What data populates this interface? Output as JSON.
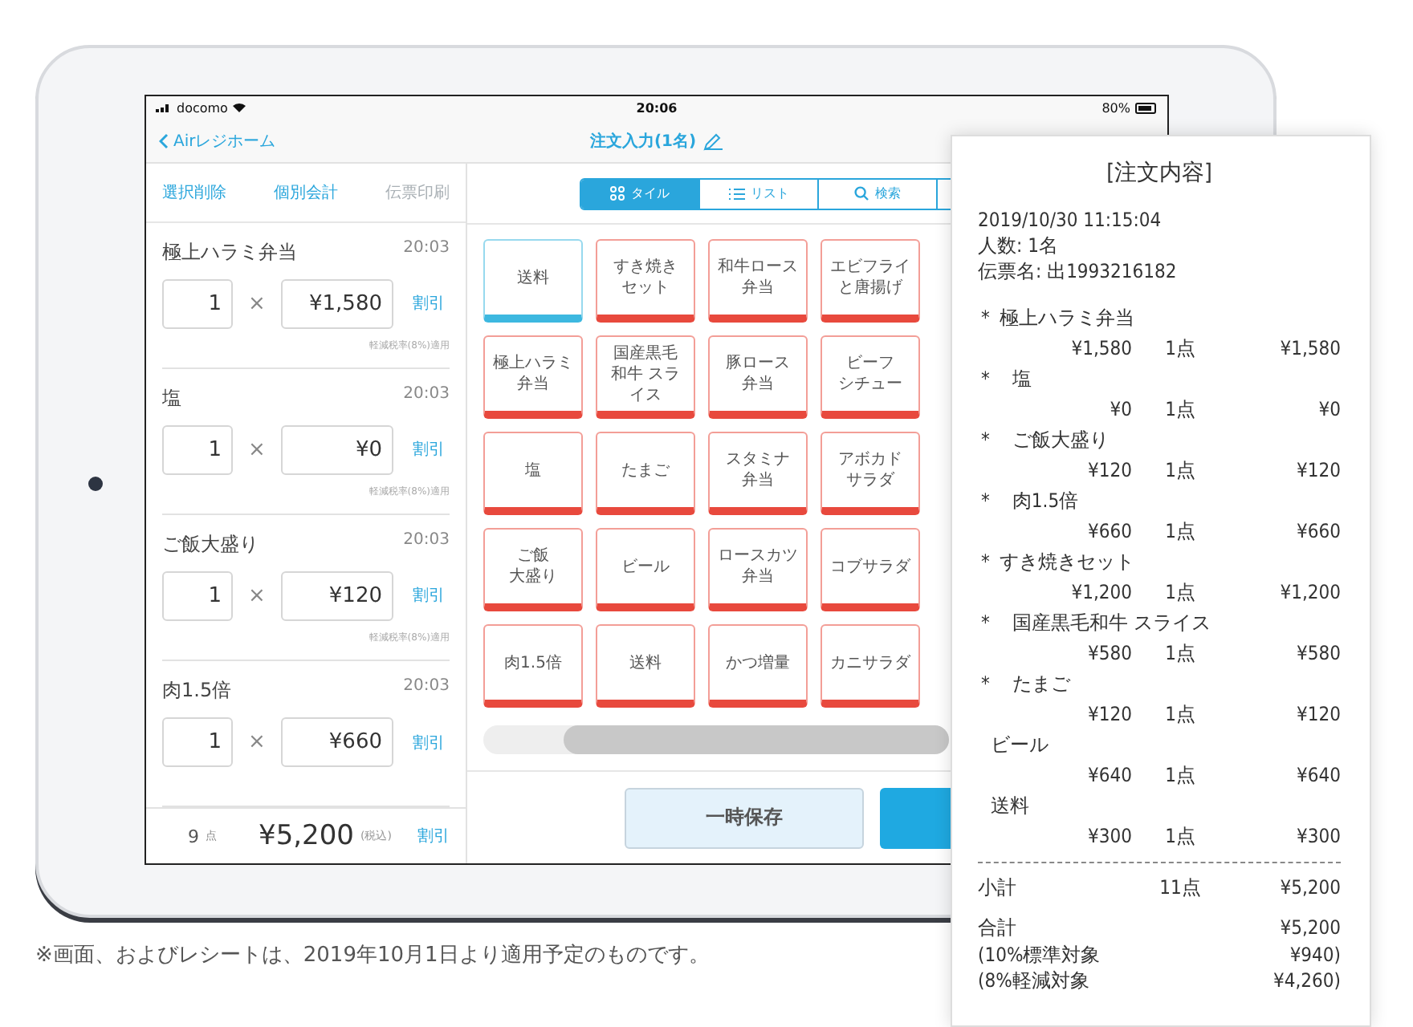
{
  "status_bar": {
    "carrier": "docomo",
    "time": "20:06",
    "battery": "80%"
  },
  "nav": {
    "back_label": "Airレジホーム",
    "title": "注文入力(1名)"
  },
  "actions": [
    {
      "label": "選択削除",
      "disabled": false
    },
    {
      "label": "個別会計",
      "disabled": false
    },
    {
      "label": "伝票印刷",
      "disabled": true
    }
  ],
  "order_items": [
    {
      "name": "極上ハラミ弁当",
      "time": "20:03",
      "qty": "1",
      "times": "×",
      "price": "¥1,580",
      "discount": "割引",
      "tax_note": "軽減税率(8%)適用"
    },
    {
      "name": "塩",
      "time": "20:03",
      "qty": "1",
      "times": "×",
      "price": "¥0",
      "discount": "割引",
      "tax_note": "軽減税率(8%)適用"
    },
    {
      "name": "ご飯大盛り",
      "time": "20:03",
      "qty": "1",
      "times": "×",
      "price": "¥120",
      "discount": "割引",
      "tax_note": "軽減税率(8%)適用"
    },
    {
      "name": "肉1.5倍",
      "time": "20:03",
      "qty": "1",
      "times": "×",
      "price": "¥660",
      "discount": "割引"
    }
  ],
  "footer": {
    "count": "9",
    "unit": "点",
    "total": "¥5,200",
    "tax": "(税込)",
    "discount": "割引"
  },
  "view_tabs": [
    {
      "label": "タイル",
      "kind": "tile",
      "selected": true
    },
    {
      "label": "リスト",
      "kind": "list",
      "selected": false
    },
    {
      "label": "検索",
      "kind": "search",
      "selected": false
    }
  ],
  "tiles": [
    {
      "lines": [
        "送料"
      ],
      "color": "#3db8e0"
    },
    {
      "lines": [
        "すき焼き",
        "セット"
      ],
      "color": "#e8493d"
    },
    {
      "lines": [
        "和牛ロース",
        "弁当"
      ],
      "color": "#e8493d"
    },
    {
      "lines": [
        "エビフライ",
        "と唐揚げ"
      ],
      "color": "#e8493d"
    },
    {
      "lines": [
        "極上ハラミ",
        "弁当"
      ],
      "color": "#e8493d"
    },
    {
      "lines": [
        "国産黒毛",
        "和牛 スラ",
        "イス"
      ],
      "color": "#e8493d"
    },
    {
      "lines": [
        "豚ロース",
        "弁当"
      ],
      "color": "#e8493d"
    },
    {
      "lines": [
        "ビーフ",
        "シチュー"
      ],
      "color": "#e8493d"
    },
    {
      "lines": [
        "塩"
      ],
      "color": "#e8493d"
    },
    {
      "lines": [
        "たまご"
      ],
      "color": "#e8493d"
    },
    {
      "lines": [
        "スタミナ",
        "弁当"
      ],
      "color": "#e8493d"
    },
    {
      "lines": [
        "アボカド",
        "サラダ"
      ],
      "color": "#e8493d"
    },
    {
      "lines": [
        "ご飯",
        "大盛り"
      ],
      "color": "#e8493d"
    },
    {
      "lines": [
        "ビール"
      ],
      "color": "#e8493d"
    },
    {
      "lines": [
        "ロースカツ",
        "弁当"
      ],
      "color": "#e8493d"
    },
    {
      "lines": [
        "コブサラダ"
      ],
      "color": "#e8493d"
    },
    {
      "lines": [
        "肉1.5倍"
      ],
      "color": "#e8493d"
    },
    {
      "lines": [
        "送料"
      ],
      "color": "#e8493d"
    },
    {
      "lines": [
        "かつ増量"
      ],
      "color": "#e8493d"
    },
    {
      "lines": [
        "カニサラダ"
      ],
      "color": "#e8493d"
    }
  ],
  "save_button": "一時保存",
  "receipt": {
    "title": "[注文内容]",
    "datetime": "2019/10/30 11:15:04",
    "people": "人数: 1名",
    "slip": "伝票名: 出1993216182",
    "lines": [
      {
        "mark": "*",
        "name": "極上ハラミ弁当",
        "indent": false,
        "unit_price": "¥1,580",
        "qty": "1点",
        "amount": "¥1,580"
      },
      {
        "mark": "*",
        "name": "塩",
        "indent": true,
        "unit_price": "¥0",
        "qty": "1点",
        "amount": "¥0"
      },
      {
        "mark": "*",
        "name": "ご飯大盛り",
        "indent": true,
        "unit_price": "¥120",
        "qty": "1点",
        "amount": "¥120"
      },
      {
        "mark": "*",
        "name": "肉1.5倍",
        "indent": true,
        "unit_price": "¥660",
        "qty": "1点",
        "amount": "¥660"
      },
      {
        "mark": "*",
        "name": "すき焼きセット",
        "indent": false,
        "unit_price": "¥1,200",
        "qty": "1点",
        "amount": "¥1,200"
      },
      {
        "mark": "*",
        "name": "国産黒毛和牛 スライス",
        "indent": true,
        "unit_price": "¥580",
        "qty": "1点",
        "amount": "¥580"
      },
      {
        "mark": "*",
        "name": "たまご",
        "indent": true,
        "unit_price": "¥120",
        "qty": "1点",
        "amount": "¥120"
      },
      {
        "name": "ビール",
        "indent": false,
        "unit_price": "¥640",
        "qty": "1点",
        "amount": "¥640"
      },
      {
        "name": "送料",
        "indent": false,
        "unit_price": "¥300",
        "qty": "1点",
        "amount": "¥300"
      }
    ],
    "subtotal": {
      "label": "小計",
      "qty": "11点",
      "amount": "¥5,200"
    },
    "total": {
      "label": "合計",
      "amount": "¥5,200"
    },
    "tax_lines": [
      {
        "label": "(10%標準対象",
        "amount": "¥940)"
      },
      {
        "label": "(8%軽減対象",
        "amount": "¥4,260)"
      }
    ]
  },
  "footnote": "※画面、およびレシートは、2019年10月1日より適用予定のものです。"
}
